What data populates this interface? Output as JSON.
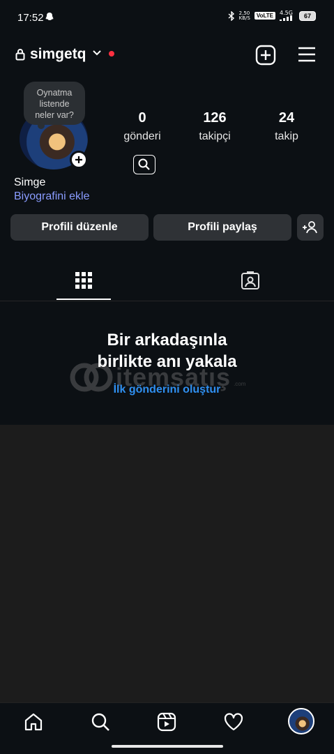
{
  "status_bar": {
    "time": "17:52",
    "network_speed_top": "2,50",
    "network_speed_bottom": "KB/S",
    "volte": "VoLTE",
    "network_type": "4.5G",
    "battery": "67"
  },
  "header": {
    "username": "simgetq"
  },
  "profile": {
    "note": "Oynatma\nlistende\nneler var?",
    "posts_count": "0",
    "posts_label": "gönderi",
    "followers_count": "126",
    "followers_label": "takipçi",
    "following_count": "24",
    "following_label": "takip",
    "name": "Simge",
    "bio_link": "Biyografini ekle"
  },
  "actions": {
    "edit_profile": "Profili düzenle",
    "share_profile": "Profili paylaş"
  },
  "empty_state": {
    "title": "Bir arkadaşınla\nbirlikte anı yakala",
    "link": "İlk gönderini oluştur"
  },
  "watermark": {
    "text": "itemsatış",
    "sub": ".com"
  },
  "colors": {
    "background": "#0c1014",
    "link_blue": "#2f8ff0",
    "bio_blue": "#8a9cff",
    "notification_red": "#ff3040",
    "button_gray": "#2f3236"
  }
}
